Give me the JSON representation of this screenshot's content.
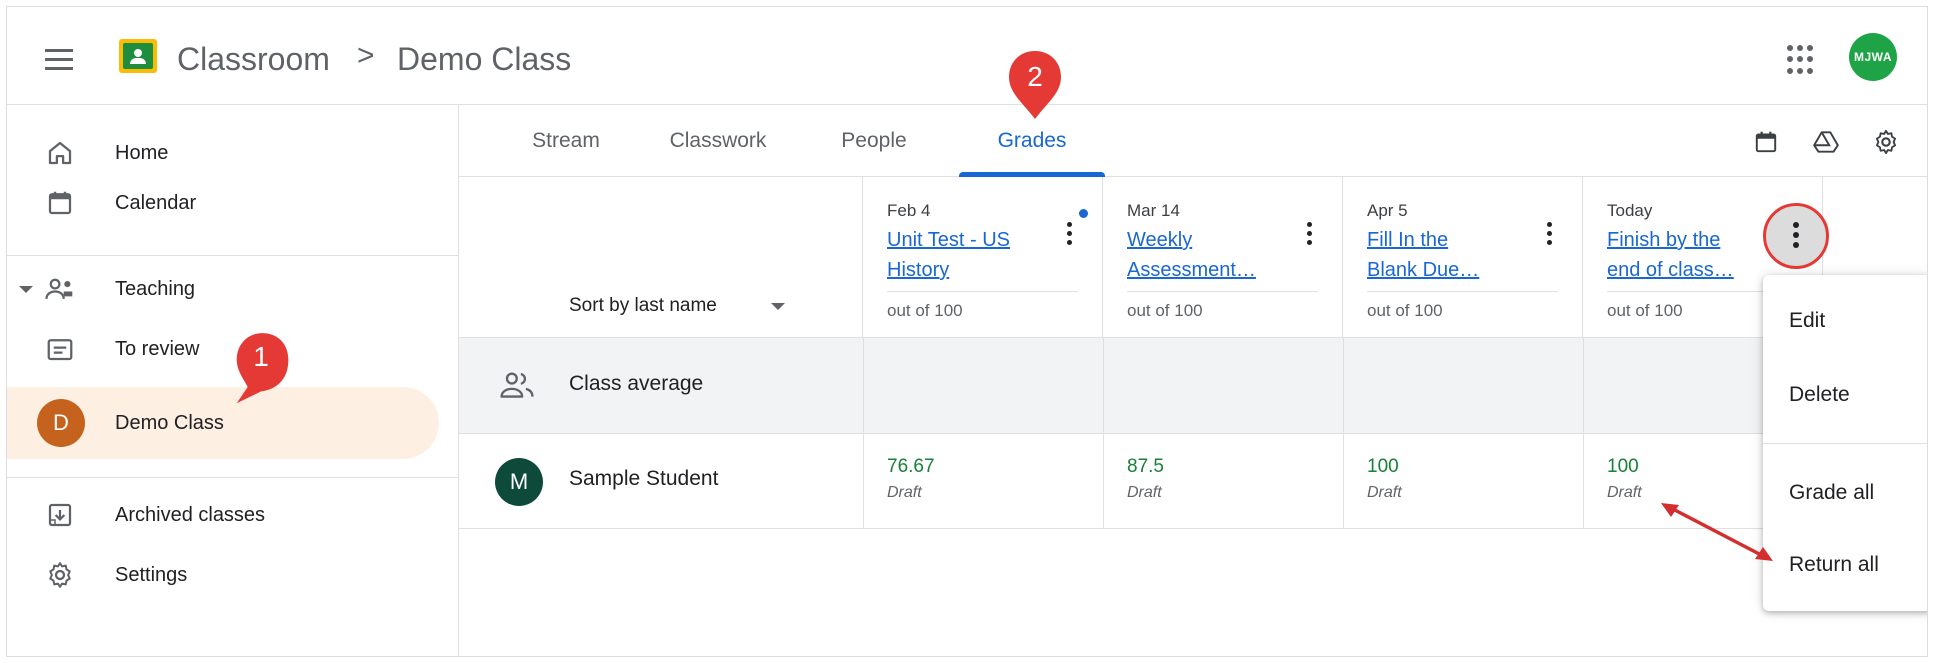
{
  "header": {
    "app_title": "Classroom",
    "separator": ">",
    "class_name": "Demo Class",
    "account_initials": "MJWA"
  },
  "sidebar": {
    "items": [
      {
        "label": "Home",
        "icon": "home-icon"
      },
      {
        "label": "Calendar",
        "icon": "calendar-icon"
      },
      {
        "label": "Teaching",
        "icon": "teaching-icon"
      },
      {
        "label": "To review",
        "icon": "to-review-icon"
      },
      {
        "label": "Demo Class",
        "initial": "D"
      },
      {
        "label": "Archived classes",
        "icon": "archive-icon"
      },
      {
        "label": "Settings",
        "icon": "settings-icon"
      }
    ]
  },
  "tabs": [
    {
      "label": "Stream"
    },
    {
      "label": "Classwork"
    },
    {
      "label": "People"
    },
    {
      "label": "Grades",
      "active": true
    }
  ],
  "grades": {
    "sort_label": "Sort by last name",
    "assignments": [
      {
        "date": "Feb 4",
        "title": "Unit Test - US History",
        "out_of": "out of 100",
        "unread_dot": true
      },
      {
        "date": "Mar 14",
        "title": "Weekly Assessment…",
        "out_of": "out of 100"
      },
      {
        "date": "Apr 5",
        "title": "Fill In the Blank Due…",
        "out_of": "out of 100"
      },
      {
        "date": "Today",
        "title": "Finish by the end of class…",
        "out_of": "out of 100"
      }
    ],
    "class_average_label": "Class average",
    "students": [
      {
        "initial": "M",
        "name": "Sample Student",
        "grades": [
          {
            "value": "76.67",
            "status": "Draft"
          },
          {
            "value": "87.5",
            "status": "Draft"
          },
          {
            "value": "100",
            "status": "Draft"
          },
          {
            "value": "100",
            "status": "Draft"
          }
        ]
      }
    ]
  },
  "menu": {
    "items": [
      "Edit",
      "Delete",
      "Grade all",
      "Return all"
    ]
  },
  "annotations": {
    "marker_1": "1",
    "marker_2": "2"
  },
  "colors": {
    "accent": "#1967d2",
    "grade_green": "#188038",
    "active_bg": "#feefe3",
    "class_avatar": "#c5621d",
    "annotation_red": "#e53935"
  }
}
